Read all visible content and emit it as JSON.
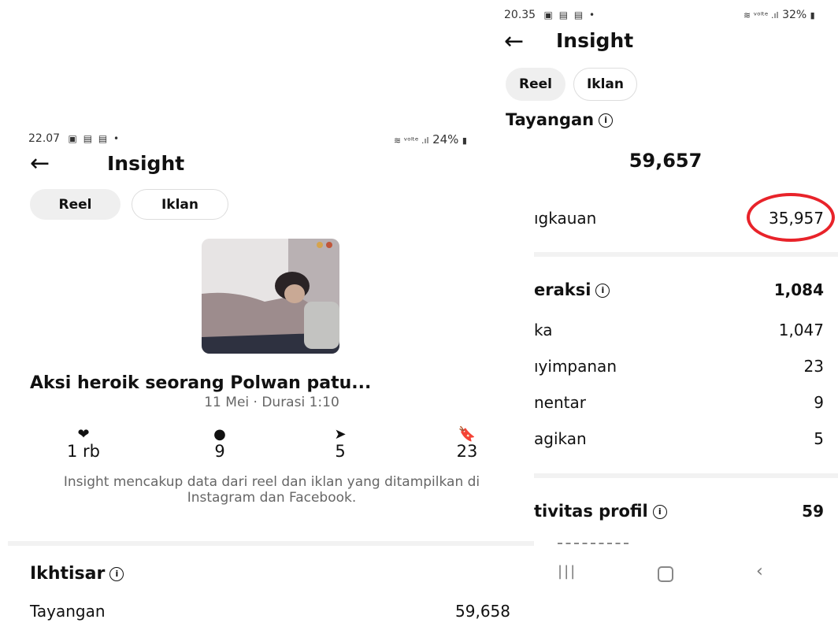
{
  "left": {
    "status": {
      "time": "22.07",
      "right": "24%"
    },
    "title": "Insight",
    "tabs": [
      {
        "label": "Reel"
      },
      {
        "label": "Iklan"
      }
    ],
    "thumbnail_caption": "",
    "post_title": "Aksi heroik seorang Polwan patu...",
    "meta": "11 Mei · Durasi 1:10",
    "stats": [
      {
        "icon": "heart-icon",
        "value": "1 rb"
      },
      {
        "icon": "comment-icon",
        "value": "9"
      },
      {
        "icon": "share-icon",
        "value": "5"
      },
      {
        "icon": "bookmark-icon",
        "value": "23"
      }
    ],
    "note": "Insight mencakup data dari reel dan iklan yang ditampilkan di Instagram dan Facebook.",
    "overview": {
      "title": "Ikhtisar",
      "views_label": "Tayangan",
      "views_value": "59,658"
    }
  },
  "right": {
    "status": {
      "time": "20.35",
      "right": "32%"
    },
    "title": "Insight",
    "tabs": [
      {
        "label": "Reel"
      },
      {
        "label": "Iklan"
      }
    ],
    "views_title": "Tayangan",
    "views_total": "59,657",
    "reach": {
      "label": "ıgkauan",
      "value": "35,957"
    },
    "interactions": {
      "title": "eraksi",
      "total": "1,084",
      "rows": [
        {
          "label": "ka",
          "value": "1,047"
        },
        {
          "label": "ıyimpanan",
          "value": "23"
        },
        {
          "label": "nentar",
          "value": "9"
        },
        {
          "label": "agikan",
          "value": "5"
        }
      ]
    },
    "profile_activity": {
      "title": "tivitas profil",
      "value": "59"
    },
    "highlight_color": "#e8232a"
  }
}
